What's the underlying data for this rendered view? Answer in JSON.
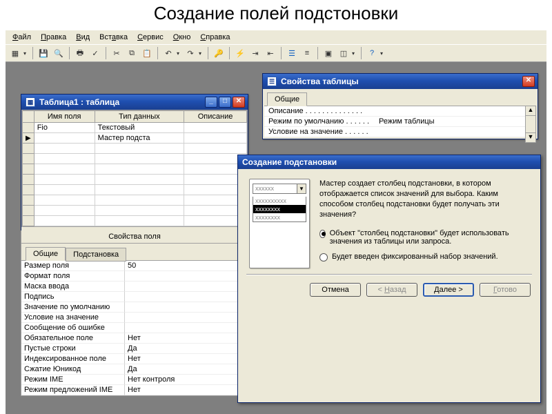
{
  "page_title": "Создание полей подстоновки",
  "menubar": [
    "Файл",
    "Правка",
    "Вид",
    "Вставка",
    "Сервис",
    "Окно",
    "Справка"
  ],
  "table_window": {
    "title": "Таблица1 : таблица",
    "columns": [
      "Имя поля",
      "Тип данных",
      "Описание"
    ],
    "rows": [
      {
        "marker": "",
        "name": "Fio",
        "type": "Текстовый",
        "desc": ""
      },
      {
        "marker": "▶",
        "name": "",
        "type": "Мастер подста",
        "desc": ""
      }
    ]
  },
  "field_props": {
    "title": "Свойства поля",
    "tabs": [
      "Общие",
      "Подстановка"
    ],
    "rows": [
      {
        "k": "Размер поля",
        "v": "50"
      },
      {
        "k": "Формат поля",
        "v": ""
      },
      {
        "k": "Маска ввода",
        "v": ""
      },
      {
        "k": "Подпись",
        "v": ""
      },
      {
        "k": "Значение по умолчанию",
        "v": ""
      },
      {
        "k": "Условие на значение",
        "v": ""
      },
      {
        "k": "Сообщение об ошибке",
        "v": ""
      },
      {
        "k": "Обязательное поле",
        "v": "Нет"
      },
      {
        "k": "Пустые строки",
        "v": "Да"
      },
      {
        "k": "Индексированное поле",
        "v": "Нет"
      },
      {
        "k": "Сжатие Юникод",
        "v": "Да"
      },
      {
        "k": "Режим IME",
        "v": "Нет контроля"
      },
      {
        "k": "Режим предложений IME",
        "v": "Нет"
      }
    ]
  },
  "table_props": {
    "title": "Свойства таблицы",
    "tab": "Общие",
    "rows": [
      {
        "k": "Описание . . . . . . . . . . . . . .",
        "v": ""
      },
      {
        "k": "Режим по умолчанию . . . . . .",
        "v": "Режим таблицы"
      },
      {
        "k": "Условие на значение . . . . . .",
        "v": ""
      }
    ]
  },
  "wizard": {
    "title": "Создание подстановки",
    "intro": "Мастер создает столбец подстановки, в котором отображается список значений для выбора. Каким способом столбец подстановки будет получать эти значения?",
    "combo_text": "xxxxxx",
    "list_items": [
      "xxxxxxxxxx",
      "xxxxxxxx",
      "xxxxxxxx"
    ],
    "option1": "Объект \"столбец подстановки\" будет использовать значения из таблицы или запроса.",
    "option2": "Будет введен фиксированный набор значений.",
    "buttons": {
      "cancel": "Отмена",
      "back": "< Назад",
      "next": "Далее >",
      "finish": "Готово"
    }
  }
}
